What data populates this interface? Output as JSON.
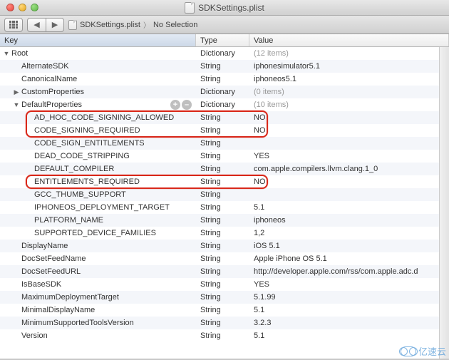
{
  "window": {
    "title": "SDKSettings.plist"
  },
  "toolbar": {
    "back": "◀",
    "forward": "▶"
  },
  "breadcrumb": {
    "file": "SDKSettings.plist",
    "selection": "No Selection"
  },
  "columns": {
    "key": "Key",
    "type": "Type",
    "value": "Value"
  },
  "rows": [
    {
      "indent": 0,
      "key": "Root",
      "type": "Dictionary",
      "value": "(12 items)",
      "faded": true,
      "disclosure": "open"
    },
    {
      "indent": 1,
      "key": "AlternateSDK",
      "type": "String",
      "value": "iphonesimulator5.1"
    },
    {
      "indent": 1,
      "key": "CanonicalName",
      "type": "String",
      "value": "iphoneos5.1"
    },
    {
      "indent": 1,
      "key": "CustomProperties",
      "type": "Dictionary",
      "value": "(0 items)",
      "faded": true,
      "disclosure": "closed"
    },
    {
      "indent": 1,
      "key": "DefaultProperties",
      "type": "Dictionary",
      "value": "(10 items)",
      "faded": true,
      "disclosure": "open",
      "hoverButtons": true
    },
    {
      "indent": 2,
      "key": "AD_HOC_CODE_SIGNING_ALLOWED",
      "type": "String",
      "value": "NO"
    },
    {
      "indent": 2,
      "key": "CODE_SIGNING_REQUIRED",
      "type": "String",
      "value": "NO"
    },
    {
      "indent": 2,
      "key": "CODE_SIGN_ENTITLEMENTS",
      "type": "String",
      "value": ""
    },
    {
      "indent": 2,
      "key": "DEAD_CODE_STRIPPING",
      "type": "String",
      "value": "YES"
    },
    {
      "indent": 2,
      "key": "DEFAULT_COMPILER",
      "type": "String",
      "value": "com.apple.compilers.llvm.clang.1_0"
    },
    {
      "indent": 2,
      "key": "ENTITLEMENTS_REQUIRED",
      "type": "String",
      "value": "NO"
    },
    {
      "indent": 2,
      "key": "GCC_THUMB_SUPPORT",
      "type": "String",
      "value": ""
    },
    {
      "indent": 2,
      "key": "IPHONEOS_DEPLOYMENT_TARGET",
      "type": "String",
      "value": "5.1"
    },
    {
      "indent": 2,
      "key": "PLATFORM_NAME",
      "type": "String",
      "value": "iphoneos"
    },
    {
      "indent": 2,
      "key": "SUPPORTED_DEVICE_FAMILIES",
      "type": "String",
      "value": "1,2"
    },
    {
      "indent": 1,
      "key": "DisplayName",
      "type": "String",
      "value": "iOS 5.1"
    },
    {
      "indent": 1,
      "key": "DocSetFeedName",
      "type": "String",
      "value": "Apple iPhone OS 5.1"
    },
    {
      "indent": 1,
      "key": "DocSetFeedURL",
      "type": "String",
      "value": "http://developer.apple.com/rss/com.apple.adc.d"
    },
    {
      "indent": 1,
      "key": "IsBaseSDK",
      "type": "String",
      "value": "YES"
    },
    {
      "indent": 1,
      "key": "MaximumDeploymentTarget",
      "type": "String",
      "value": "5.1.99"
    },
    {
      "indent": 1,
      "key": "MinimalDisplayName",
      "type": "String",
      "value": "5.1"
    },
    {
      "indent": 1,
      "key": "MinimumSupportedToolsVersion",
      "type": "String",
      "value": "3.2.3"
    },
    {
      "indent": 1,
      "key": "Version",
      "type": "String",
      "value": "5.1"
    }
  ],
  "watermark": "亿速云"
}
